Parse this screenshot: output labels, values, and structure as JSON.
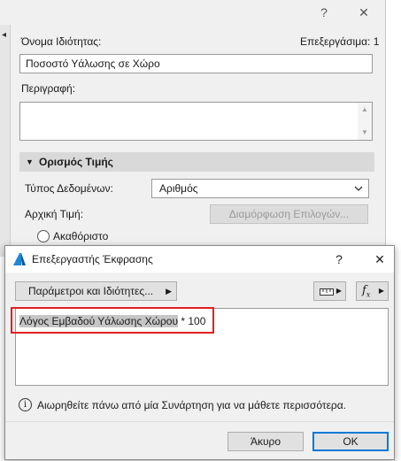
{
  "property_dialog": {
    "help_label": "?",
    "close_label": "✕",
    "collapse_arrow": "◂",
    "property_name_label": "Όνομα Ιδιότητας:",
    "editable_label": "Επεξεργάσιμα: 1",
    "property_name_value": "Ποσοστό Υάλωσης σε Χώρο",
    "description_label": "Περιγραφή:",
    "description_value": "",
    "scroll_up": "▲",
    "scroll_down": "▼",
    "value_definition_label": "Ορισμός Τιμής",
    "data_type_label": "Τύπος Δεδομένων:",
    "data_type_value": "Αριθμός",
    "initial_value_label": "Αρχική Τιμή:",
    "configure_options_label": "Διαμόρφωση Επιλογών...",
    "undefined_label": "Ακαθόριστο"
  },
  "expression_editor": {
    "title": "Επεξεργαστής Έκφρασης",
    "help_label": "?",
    "close_label": "✕",
    "parameters_button_label": "Παράμετροι και Ιδιότητες...",
    "expression_selected": "Λόγος Εμβαδού Υάλωσης Χώρου",
    "expression_rest": " * 100",
    "hint_text": "Αιωρηθείτε πάνω από μία Συνάρτηση για να μάθετε περισσότερα.",
    "cancel_label": "Άκυρο",
    "ok_label": "OK",
    "highlight_color": "#e02020",
    "accent_color": "#0078d7"
  }
}
